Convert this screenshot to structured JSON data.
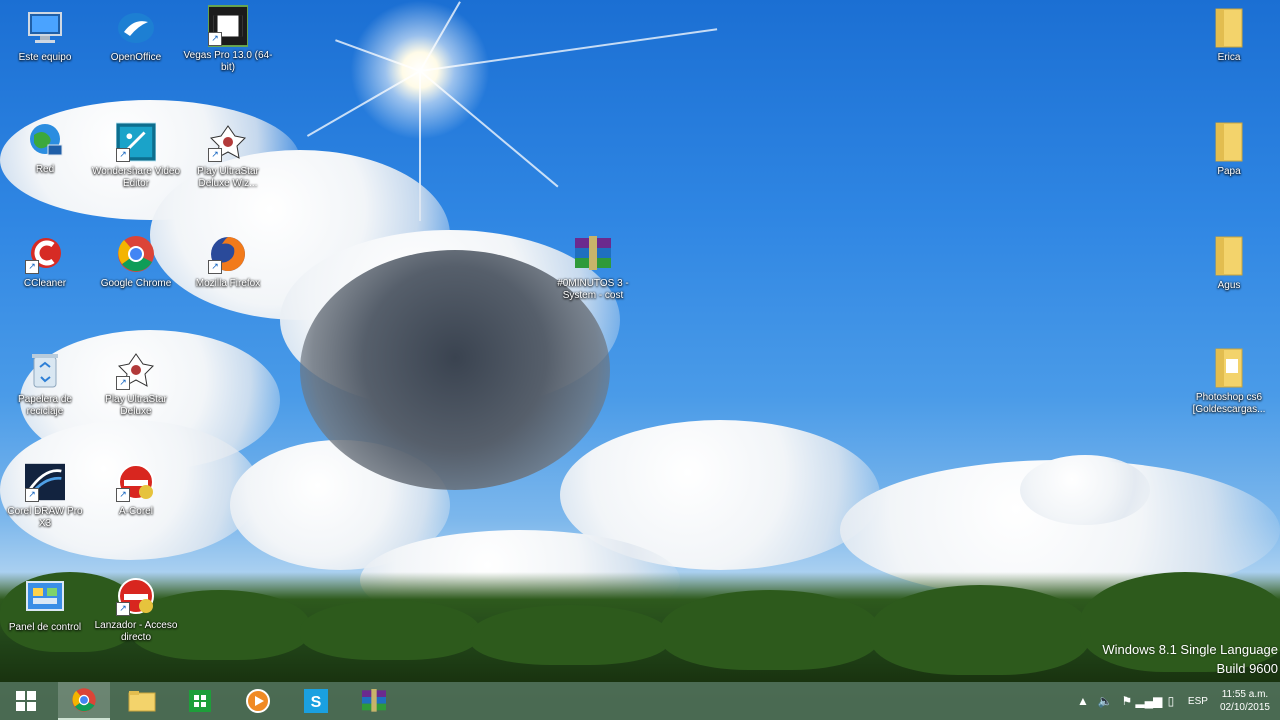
{
  "desktop": {
    "icons": {
      "este_equipo": "Este equipo",
      "openoffice": "OpenOffice",
      "vegas_pro": "Vegas Pro 13.0 (64-bit)",
      "red": "Red",
      "wondershare": "Wondershare Video Editor",
      "play_ultrastar_wiz": "Play UltraStar Deluxe Wiz...",
      "ccleaner": "CCleaner",
      "google_chrome": "Google Chrome",
      "mozilla_firefox": "Mozilla Firefox",
      "rar_file": "#0MINUTOS 3 - System - cost",
      "papelera": "Papelera de reciclaje",
      "play_ultrastar": "Play UltraStar Deluxe",
      "corel_draw": "Corel DRAW Pro X3",
      "acorel": "A-Corel",
      "panel_control": "Panel de control",
      "lanzador": "Lanzador - Acceso directo",
      "folder_erica": "Erica",
      "folder_papa": "Papa",
      "folder_agus": "Agus",
      "folder_photoshop": "Photoshop cs6 [Goldescargas..."
    },
    "watermark": {
      "line1": "Windows 8.1 Single Language",
      "line2": "Build 9600"
    }
  },
  "taskbar": {
    "language": "ESP",
    "time": "11:55 a.m.",
    "date": "02/10/2015"
  },
  "colors": {
    "taskbar": "#4e6e58",
    "sky": "#2f86e3",
    "folder": "#f3d36b"
  }
}
